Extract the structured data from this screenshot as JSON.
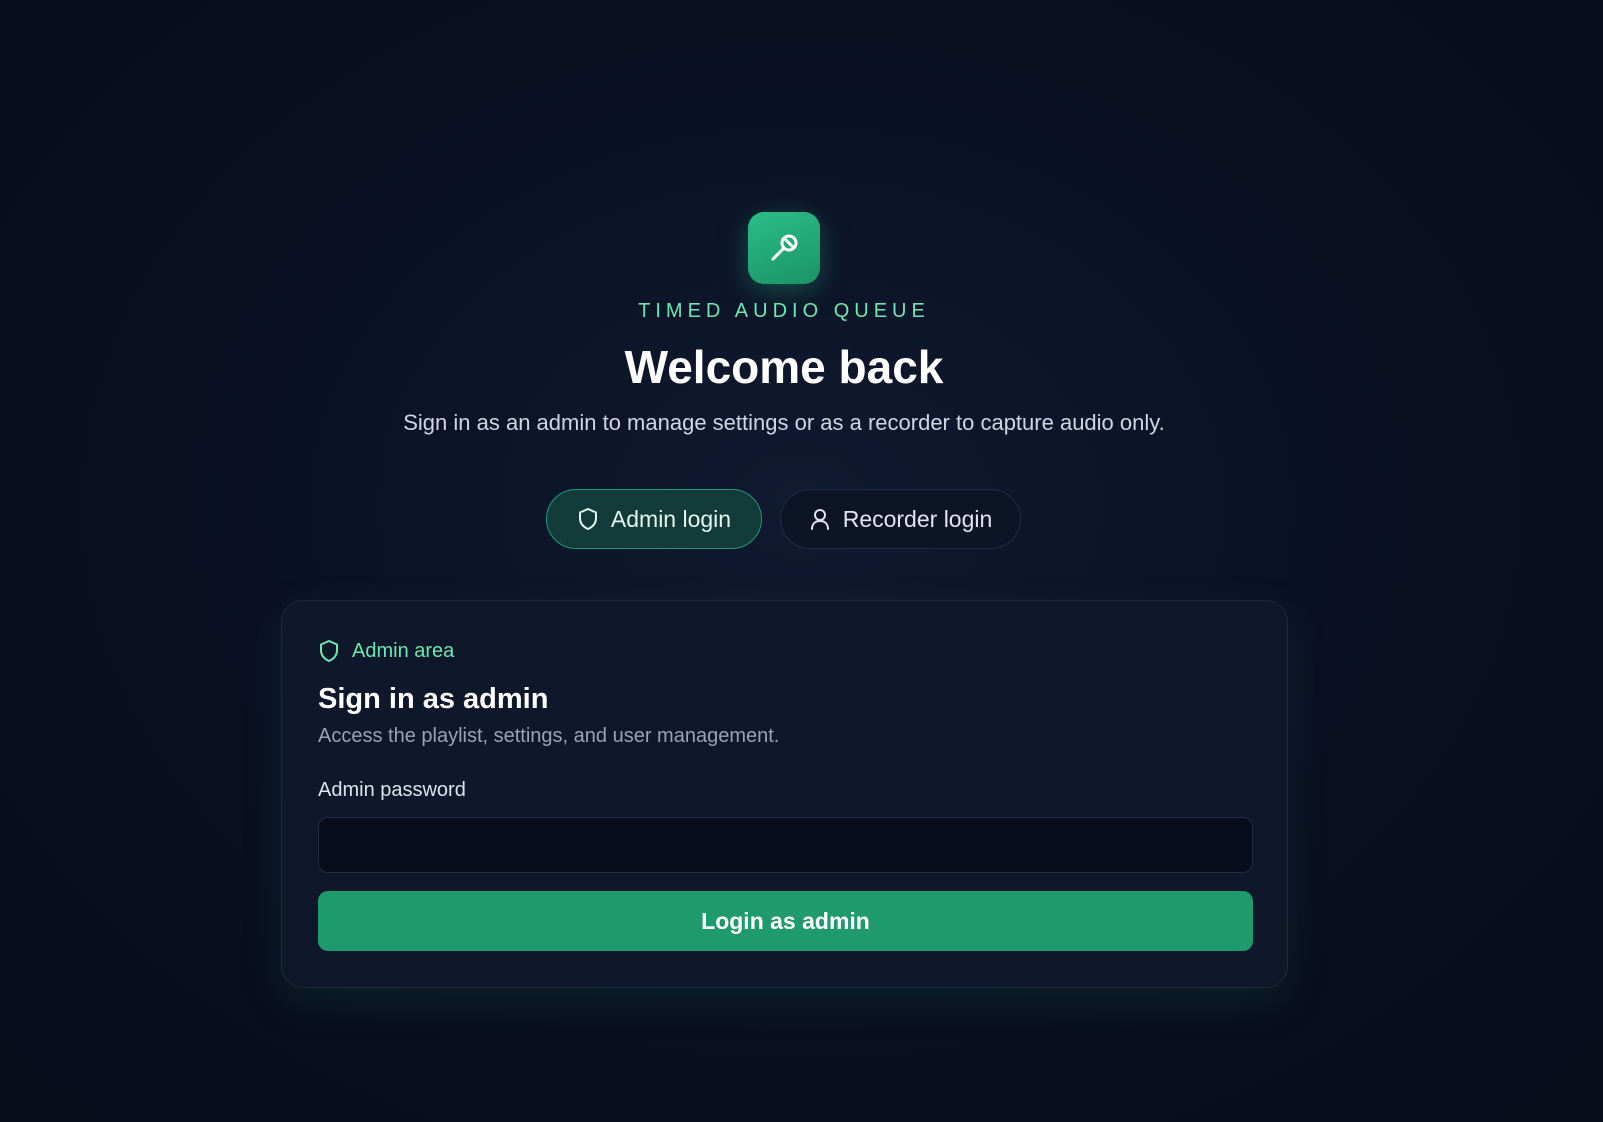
{
  "brand": {
    "logo_icon": "microphone-icon",
    "app_name": "TIMED AUDIO QUEUE",
    "accent_color": "#2bbd87"
  },
  "header": {
    "title": "Welcome back",
    "subtitle": "Sign in as an admin to manage settings or as a recorder to capture audio only."
  },
  "role_tabs": [
    {
      "label": "Admin login",
      "icon": "shield-icon",
      "selected": true
    },
    {
      "label": "Recorder login",
      "icon": "user-icon",
      "selected": false
    }
  ],
  "card": {
    "area_label": "Admin area",
    "area_icon": "shield-icon",
    "title": "Sign in as admin",
    "description": "Access the playlist, settings, and user management.",
    "password_label": "Admin password",
    "password_value": "",
    "submit_label": "Login as admin",
    "submit_color": "#1f9a6d"
  }
}
